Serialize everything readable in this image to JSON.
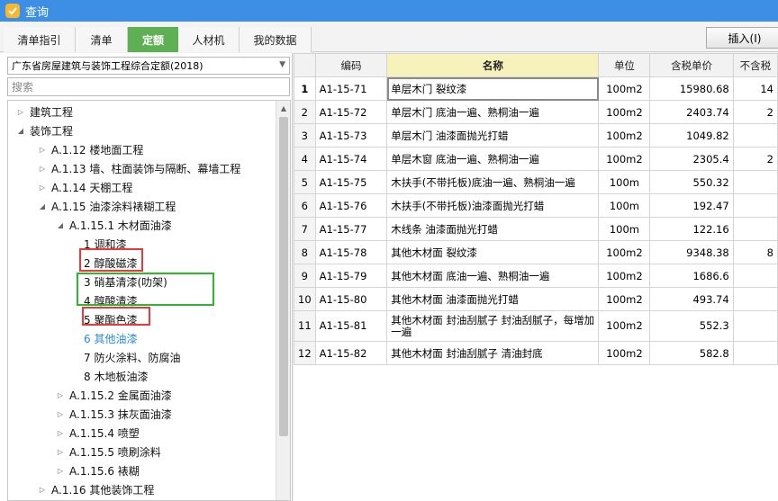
{
  "window": {
    "title": "查询"
  },
  "tabs": [
    {
      "label": "清单指引"
    },
    {
      "label": "清单"
    },
    {
      "label": "定额",
      "active": true
    },
    {
      "label": "人材机"
    },
    {
      "label": "我的数据"
    }
  ],
  "toolbar": {
    "insert_label": "插入(I)"
  },
  "left": {
    "library_select": "广东省房屋建筑与装饰工程综合定额(2018)",
    "search_placeholder": "搜索"
  },
  "tree": [
    {
      "label": "建筑工程",
      "caret": "collapsed"
    },
    {
      "label": "装饰工程",
      "caret": "expanded"
    },
    {
      "label": "A.1.12 楼地面工程",
      "caret": "collapsed"
    },
    {
      "label": "A.1.13 墙、柱面装饰与隔断、幕墙工程",
      "caret": "collapsed"
    },
    {
      "label": "A.1.14 天棚工程",
      "caret": "collapsed"
    },
    {
      "label": "A.1.15 油漆涂料裱糊工程",
      "caret": "expanded"
    },
    {
      "label": "A.1.15.1 木材面油漆",
      "caret": "expanded"
    },
    {
      "label": "1 调和漆",
      "caret": "none"
    },
    {
      "label": "2 醇酸磁漆",
      "caret": "none"
    },
    {
      "label": "3 硝基清漆(叻架)",
      "caret": "none"
    },
    {
      "label": "4 醇酸清漆",
      "caret": "none"
    },
    {
      "label": "5 聚酯色漆",
      "caret": "none"
    },
    {
      "label": "6 其他油漆",
      "caret": "none",
      "highlight": true
    },
    {
      "label": "7 防火涂料、防腐油",
      "caret": "none"
    },
    {
      "label": "8 木地板油漆",
      "caret": "none"
    },
    {
      "label": "A.1.15.2 金属面油漆",
      "caret": "collapsed"
    },
    {
      "label": "A.1.15.3 抹灰面油漆",
      "caret": "collapsed"
    },
    {
      "label": "A.1.15.4 喷塑",
      "caret": "collapsed"
    },
    {
      "label": "A.1.15.5 喷刷涂料",
      "caret": "collapsed"
    },
    {
      "label": "A.1.15.6 裱糊",
      "caret": "collapsed"
    },
    {
      "label": "A.1.16 其他装饰工程",
      "caret": "collapsed"
    }
  ],
  "table": {
    "columns": [
      "编码",
      "名称",
      "单位",
      "含税单价",
      "不含税"
    ],
    "rows": [
      {
        "no": "1",
        "code": "A1-15-71",
        "name": "单层木门 裂纹漆",
        "unit": "100m2",
        "price": "15980.68",
        "extra": "14"
      },
      {
        "no": "2",
        "code": "A1-15-72",
        "name": "单层木门 底油一遍、熟桐油一遍",
        "unit": "100m2",
        "price": "2403.74",
        "extra": "2"
      },
      {
        "no": "3",
        "code": "A1-15-73",
        "name": "单层木门 油漆面抛光打蜡",
        "unit": "100m2",
        "price": "1049.82",
        "extra": ""
      },
      {
        "no": "4",
        "code": "A1-15-74",
        "name": "单层木窗 底油一遍、熟桐油一遍",
        "unit": "100m2",
        "price": "2305.4",
        "extra": "2"
      },
      {
        "no": "5",
        "code": "A1-15-75",
        "name": "木扶手(不带托板)底油一遍、熟桐油一遍",
        "unit": "100m",
        "price": "550.32",
        "extra": ""
      },
      {
        "no": "6",
        "code": "A1-15-76",
        "name": "木扶手(不带托板)油漆面抛光打蜡",
        "unit": "100m",
        "price": "192.47",
        "extra": ""
      },
      {
        "no": "7",
        "code": "A1-15-77",
        "name": "木线条 油漆面抛光打蜡",
        "unit": "100m",
        "price": "122.16",
        "extra": ""
      },
      {
        "no": "8",
        "code": "A1-15-78",
        "name": "其他木材面 裂纹漆",
        "unit": "100m2",
        "price": "9348.38",
        "extra": "8"
      },
      {
        "no": "9",
        "code": "A1-15-79",
        "name": "其他木材面 底油一遍、熟桐油一遍",
        "unit": "100m2",
        "price": "1686.6",
        "extra": ""
      },
      {
        "no": "10",
        "code": "A1-15-80",
        "name": "其他木材面 油漆面抛光打蜡",
        "unit": "100m2",
        "price": "493.74",
        "extra": ""
      },
      {
        "no": "11",
        "code": "A1-15-81",
        "name": "其他木材面 封油刮腻子 封油刮腻子，每增加一遍",
        "unit": "100m2",
        "price": "552.3",
        "extra": ""
      },
      {
        "no": "12",
        "code": "A1-15-82",
        "name": "其他木材面 封油刮腻子 清油封底",
        "unit": "100m2",
        "price": "582.8",
        "extra": ""
      }
    ]
  },
  "colors": {
    "titlebar": "#3d8fe6",
    "active_tab": "#5fb055",
    "name_header": "#f7f2bc",
    "red_box": "#e83a3a",
    "green_box": "#2fb52f",
    "tree_link": "#2a8bd8"
  }
}
